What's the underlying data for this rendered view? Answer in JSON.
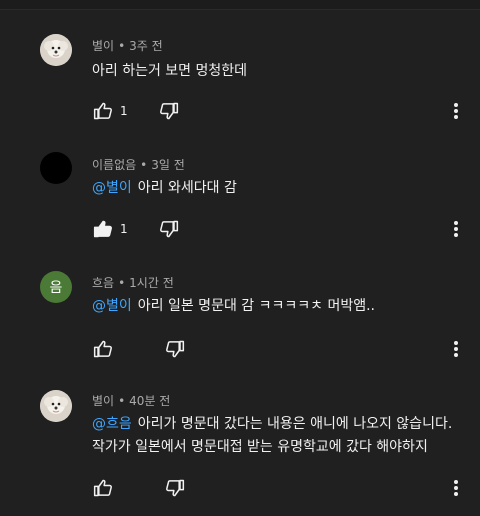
{
  "comments": [
    {
      "author": "별이",
      "time": "3주 전",
      "separator": "•",
      "mention": "",
      "text": "아리 하는거 보면 멍청한데",
      "likes": "1",
      "liked": false,
      "avatar": "dog"
    },
    {
      "author": "이름없음",
      "time": "3일 전",
      "separator": "•",
      "mention": "@별이",
      "text": "아리 와세다대 감",
      "likes": "1",
      "liked": true,
      "avatar": "black"
    },
    {
      "author": "흐음",
      "time": "1시간 전",
      "separator": "•",
      "mention": "@별이",
      "text": "아리 일본 명문대 감 ㅋㅋㅋㅋㅊ 머박앰..",
      "likes": "",
      "liked": false,
      "avatar": "letter",
      "avatar_letter": "음"
    },
    {
      "author": "별이",
      "time": "40분 전",
      "separator": "•",
      "mention": "@흐음",
      "text": "아리가 명문대 갔다는 내용은 애니에 나오지 않습니다.작가가 일본에서 명문대접 받는 유명학교에 갔다 해야하지",
      "likes": "",
      "liked": false,
      "avatar": "dog"
    }
  ],
  "colors": {
    "background": "#202020",
    "mention": "#3ea6ff",
    "meta": "#aaaaaa",
    "text": "#f1f1f1"
  },
  "icons": {
    "like": "thumb-up-icon",
    "dislike": "thumb-down-icon",
    "more": "more-vert-icon"
  }
}
